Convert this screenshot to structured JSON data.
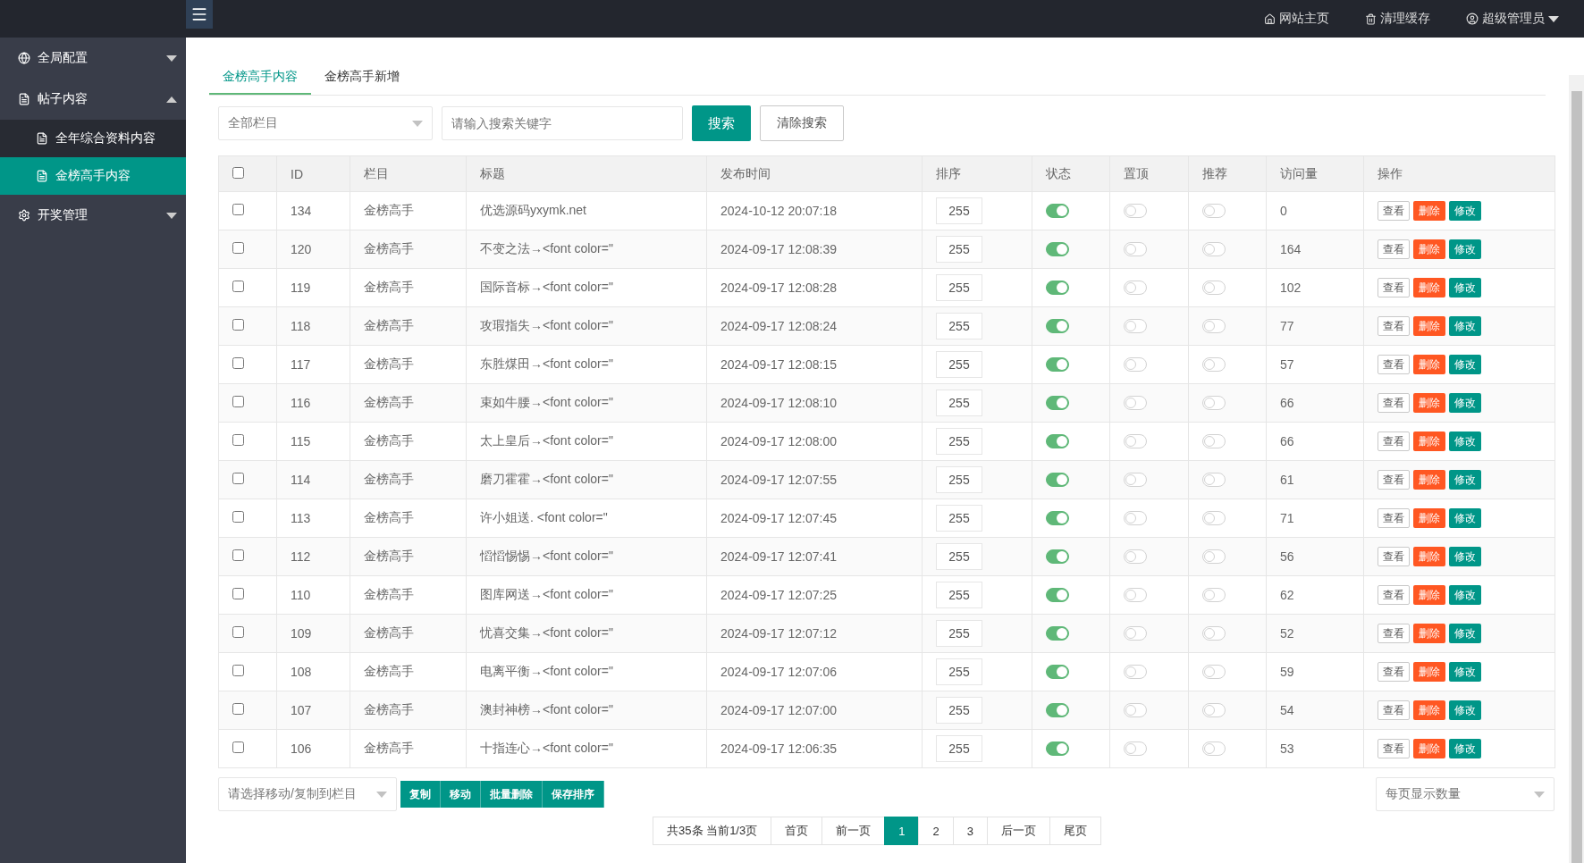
{
  "header": {
    "nav": [
      {
        "kind": "home",
        "label": "网站主页"
      },
      {
        "kind": "trash",
        "label": "清理缓存"
      },
      {
        "kind": "user",
        "label": "超级管理员",
        "dropdown": true
      }
    ]
  },
  "sidebar": {
    "items": [
      {
        "kind": "globe",
        "label": "全局配置",
        "expanded": false
      },
      {
        "kind": "file",
        "label": "帖子内容",
        "expanded": true,
        "children": [
          {
            "label": "全年综合资料内容",
            "selected": false
          },
          {
            "label": "金榜高手内容",
            "selected": true
          }
        ]
      },
      {
        "kind": "gear",
        "label": "开奖管理",
        "expanded": false
      }
    ]
  },
  "tabs": [
    {
      "label": "金榜高手内容",
      "selected": true
    },
    {
      "label": "金榜高手新增",
      "selected": false
    }
  ],
  "filter": {
    "category": "全部栏目",
    "search_placeholder": "请输入搜索关键字",
    "search_button": "搜索",
    "clear_button": "清除搜索"
  },
  "table": {
    "columns": [
      "ID",
      "栏目",
      "标题",
      "发布时间",
      "排序",
      "状态",
      "置顶",
      "推荐",
      "访问量",
      "操作"
    ],
    "all_checked": false,
    "rows": [
      {
        "checked": false,
        "id": "134",
        "category": "金榜高手",
        "title": "优选源码yxymk.net",
        "time": "2024-10-12 20:07:18",
        "sort": "255",
        "status": true,
        "top": false,
        "recommend": false,
        "views": "0",
        "actions": [
          "查看",
          "删除",
          "修改"
        ]
      },
      {
        "checked": false,
        "id": "120",
        "category": "金榜高手",
        "title": "不变之法→<font color=\"",
        "time": "2024-09-17 12:08:39",
        "sort": "255",
        "status": true,
        "top": false,
        "recommend": false,
        "views": "164",
        "actions": [
          "查看",
          "删除",
          "修改"
        ]
      },
      {
        "checked": false,
        "id": "119",
        "category": "金榜高手",
        "title": "国际音标→<font color=\"",
        "time": "2024-09-17 12:08:28",
        "sort": "255",
        "status": true,
        "top": false,
        "recommend": false,
        "views": "102",
        "actions": [
          "查看",
          "删除",
          "修改"
        ]
      },
      {
        "checked": false,
        "id": "118",
        "category": "金榜高手",
        "title": "攻瑕指失→<font color=\"",
        "time": "2024-09-17 12:08:24",
        "sort": "255",
        "status": true,
        "top": false,
        "recommend": false,
        "views": "77",
        "actions": [
          "查看",
          "删除",
          "修改"
        ]
      },
      {
        "checked": false,
        "id": "117",
        "category": "金榜高手",
        "title": "东胜煤田→<font color=\"",
        "time": "2024-09-17 12:08:15",
        "sort": "255",
        "status": true,
        "top": false,
        "recommend": false,
        "views": "57",
        "actions": [
          "查看",
          "删除",
          "修改"
        ]
      },
      {
        "checked": false,
        "id": "116",
        "category": "金榜高手",
        "title": "束如牛腰→<font color=\"",
        "time": "2024-09-17 12:08:10",
        "sort": "255",
        "status": true,
        "top": false,
        "recommend": false,
        "views": "66",
        "actions": [
          "查看",
          "删除",
          "修改"
        ]
      },
      {
        "checked": false,
        "id": "115",
        "category": "金榜高手",
        "title": "太上皇后→<font color=\"",
        "time": "2024-09-17 12:08:00",
        "sort": "255",
        "status": true,
        "top": false,
        "recommend": false,
        "views": "66",
        "actions": [
          "查看",
          "删除",
          "修改"
        ]
      },
      {
        "checked": false,
        "id": "114",
        "category": "金榜高手",
        "title": "磨刀霍霍→<font color=\"",
        "time": "2024-09-17 12:07:55",
        "sort": "255",
        "status": true,
        "top": false,
        "recommend": false,
        "views": "61",
        "actions": [
          "查看",
          "删除",
          "修改"
        ]
      },
      {
        "checked": false,
        "id": "113",
        "category": "金榜高手",
        "title": "许小姐送. <font color=\"",
        "time": "2024-09-17 12:07:45",
        "sort": "255",
        "status": true,
        "top": false,
        "recommend": false,
        "views": "71",
        "actions": [
          "查看",
          "删除",
          "修改"
        ]
      },
      {
        "checked": false,
        "id": "112",
        "category": "金榜高手",
        "title": "慆慆惕惕→<font color=\"",
        "time": "2024-09-17 12:07:41",
        "sort": "255",
        "status": true,
        "top": false,
        "recommend": false,
        "views": "56",
        "actions": [
          "查看",
          "删除",
          "修改"
        ]
      },
      {
        "checked": false,
        "id": "110",
        "category": "金榜高手",
        "title": "图库网送→<font color=\"",
        "time": "2024-09-17 12:07:25",
        "sort": "255",
        "status": true,
        "top": false,
        "recommend": false,
        "views": "62",
        "actions": [
          "查看",
          "删除",
          "修改"
        ]
      },
      {
        "checked": false,
        "id": "109",
        "category": "金榜高手",
        "title": "忧喜交集→<font color=\"",
        "time": "2024-09-17 12:07:12",
        "sort": "255",
        "status": true,
        "top": false,
        "recommend": false,
        "views": "52",
        "actions": [
          "查看",
          "删除",
          "修改"
        ]
      },
      {
        "checked": false,
        "id": "108",
        "category": "金榜高手",
        "title": "电离平衡→<font color=\"",
        "time": "2024-09-17 12:07:06",
        "sort": "255",
        "status": true,
        "top": false,
        "recommend": false,
        "views": "59",
        "actions": [
          "查看",
          "删除",
          "修改"
        ]
      },
      {
        "checked": false,
        "id": "107",
        "category": "金榜高手",
        "title": "澳封神榜→<font color=\"",
        "time": "2024-09-17 12:07:00",
        "sort": "255",
        "status": true,
        "top": false,
        "recommend": false,
        "views": "54",
        "actions": [
          "查看",
          "删除",
          "修改"
        ]
      },
      {
        "checked": false,
        "id": "106",
        "category": "金榜高手",
        "title": "十指连心→<font color=\"",
        "time": "2024-09-17 12:06:35",
        "sort": "255",
        "status": true,
        "top": false,
        "recommend": false,
        "views": "53",
        "actions": [
          "查看",
          "删除",
          "修改"
        ]
      }
    ]
  },
  "bulk": {
    "target_placeholder": "请选择移动/复制到栏目",
    "buttons": [
      "复制",
      "移动",
      "批量删除",
      "保存排序"
    ],
    "page_size_placeholder": "每页显示数量"
  },
  "pagination": {
    "summary": "共35条 当前1/3页",
    "items": [
      {
        "label": "首页",
        "selected": false
      },
      {
        "label": "前一页",
        "selected": false
      },
      {
        "label": "1",
        "selected": true
      },
      {
        "label": "2",
        "selected": false
      },
      {
        "label": "3",
        "selected": false
      },
      {
        "label": "后一页",
        "selected": false
      },
      {
        "label": "尾页",
        "selected": false
      }
    ]
  }
}
